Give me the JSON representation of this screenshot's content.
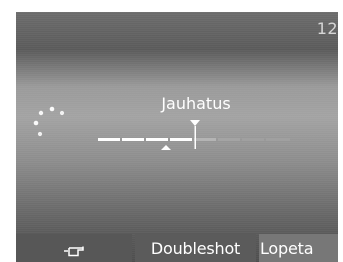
{
  "status": {
    "time": "12:"
  },
  "grind": {
    "title": "Jauhatus",
    "level_fraction": 0.5,
    "selected_fraction": 0.37
  },
  "buttons": {
    "cup_icon": "cup-icon",
    "doubleshot_label": "Doubleshot",
    "stop_label": "Lopeta"
  },
  "colors": {
    "active_segment": "#ffffff",
    "inactive_segment": "#9a9a9a",
    "stop_button": "#777777"
  }
}
